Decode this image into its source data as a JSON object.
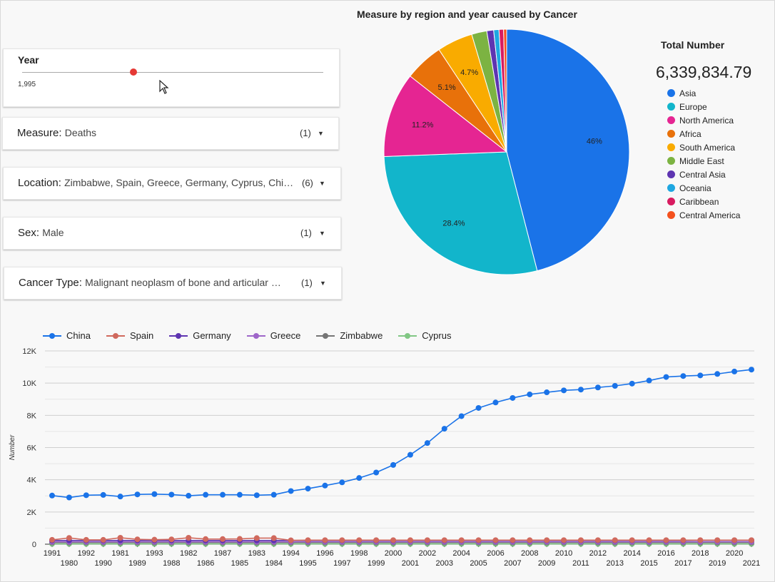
{
  "year_filter": {
    "title": "Year",
    "value": "1,995",
    "level": 0.37
  },
  "filters": [
    {
      "name": "Measure",
      "value": "Deaths",
      "count": "(1)"
    },
    {
      "name": "Location",
      "value": "Zimbabwe, Spain, Greece, Germany, Cyprus, Chi…",
      "count": "(6)"
    },
    {
      "name": "Sex",
      "value": "Male",
      "count": "(1)"
    },
    {
      "name": "Cancer Type",
      "value": "Malignant neoplasm of bone and articular …",
      "count": "(1)"
    }
  ],
  "pie": {
    "title": "Measure by region and year caused by Cancer",
    "total_title": "Total Number",
    "total_value": "6,339,834.79"
  },
  "line_legend": [
    "China",
    "Spain",
    "Germany",
    "Greece",
    "Zimbabwe",
    "Cyprus"
  ],
  "chart_data": [
    {
      "type": "pie",
      "title": "Measure by region and year caused by Cancer",
      "categories": [
        "Asia",
        "Europe",
        "North America",
        "Africa",
        "South America",
        "Middle East",
        "Central Asia",
        "Oceania",
        "Caribbean",
        "Central America"
      ],
      "values": [
        46,
        28.4,
        11.2,
        5.1,
        4.7,
        2.0,
        0.9,
        0.7,
        0.6,
        0.4
      ],
      "labels": [
        "46%",
        "28.4%",
        "11.2%",
        "5.1%",
        "4.7%",
        "",
        "",
        "",
        "",
        ""
      ],
      "colors": [
        "#1a73e8",
        "#12b5cb",
        "#e52592",
        "#e8710a",
        "#f9ab00",
        "#7cb342",
        "#5e35b1",
        "#1ea7e1",
        "#d81b60",
        "#f4511e"
      ],
      "legend_position": "right"
    },
    {
      "type": "line",
      "x": [
        "1991",
        "1980",
        "1992",
        "1990",
        "1981",
        "1989",
        "1993",
        "1988",
        "1982",
        "1986",
        "1987",
        "1985",
        "1983",
        "1984",
        "1994",
        "1995",
        "1996",
        "1997",
        "1998",
        "1999",
        "2000",
        "2001",
        "2002",
        "2003",
        "2004",
        "2005",
        "2006",
        "2007",
        "2008",
        "2009",
        "2010",
        "2011",
        "2012",
        "2013",
        "2014",
        "2015",
        "2016",
        "2017",
        "2018",
        "2019",
        "2020",
        "2021"
      ],
      "ylabel": "Number",
      "ylim": [
        0,
        12000
      ],
      "yticks": [
        "0",
        "2K",
        "4K",
        "6K",
        "8K",
        "10K",
        "12K"
      ],
      "grid": true,
      "legend_position": "top",
      "series": [
        {
          "name": "China",
          "color": "#1a73e8",
          "values": [
            3020,
            2900,
            3040,
            3060,
            2960,
            3090,
            3110,
            3080,
            3010,
            3070,
            3070,
            3070,
            3040,
            3070,
            3300,
            3450,
            3640,
            3840,
            4110,
            4450,
            4920,
            5550,
            6280,
            7170,
            7950,
            8460,
            8800,
            9080,
            9300,
            9430,
            9550,
            9600,
            9730,
            9830,
            9970,
            10160,
            10380,
            10440,
            10480,
            10570,
            10720,
            10840
          ]
        },
        {
          "name": "Spain",
          "color": "#d0695d",
          "values": [
            270,
            390,
            270,
            270,
            400,
            300,
            280,
            300,
            400,
            320,
            320,
            330,
            380,
            380,
            240,
            250,
            250,
            250,
            250,
            250,
            250,
            250,
            250,
            250,
            250,
            250,
            250,
            250,
            250,
            250,
            250,
            250,
            250,
            250,
            250,
            250,
            250,
            250,
            250,
            250,
            250,
            250
          ]
        },
        {
          "name": "Germany",
          "color": "#5e35b1",
          "values": [
            230,
            230,
            230,
            230,
            230,
            230,
            230,
            230,
            230,
            230,
            230,
            230,
            230,
            230,
            230,
            230,
            230,
            230,
            230,
            230,
            230,
            230,
            230,
            230,
            230,
            230,
            230,
            230,
            230,
            230,
            230,
            230,
            230,
            230,
            230,
            230,
            230,
            230,
            240,
            240,
            240,
            240
          ]
        },
        {
          "name": "Greece",
          "color": "#9e66c9",
          "values": [
            150,
            150,
            150,
            150,
            150,
            150,
            150,
            150,
            150,
            150,
            150,
            150,
            150,
            150,
            150,
            150,
            150,
            150,
            150,
            150,
            150,
            150,
            150,
            150,
            150,
            150,
            150,
            150,
            150,
            150,
            150,
            150,
            150,
            150,
            150,
            150,
            150,
            150,
            150,
            150,
            150,
            150
          ]
        },
        {
          "name": "Zimbabwe",
          "color": "#757575",
          "values": [
            100,
            100,
            100,
            100,
            100,
            100,
            100,
            100,
            100,
            100,
            100,
            100,
            100,
            100,
            100,
            100,
            100,
            100,
            100,
            100,
            100,
            100,
            100,
            100,
            100,
            100,
            100,
            100,
            100,
            100,
            100,
            100,
            100,
            100,
            100,
            100,
            100,
            100,
            100,
            100,
            100,
            100
          ]
        },
        {
          "name": "Cyprus",
          "color": "#81c784",
          "values": [
            20,
            20,
            20,
            20,
            20,
            20,
            20,
            20,
            20,
            20,
            20,
            20,
            20,
            20,
            20,
            20,
            20,
            20,
            20,
            20,
            20,
            20,
            20,
            20,
            20,
            20,
            20,
            20,
            20,
            20,
            20,
            20,
            20,
            20,
            20,
            20,
            20,
            20,
            20,
            20,
            20,
            20
          ]
        }
      ]
    }
  ]
}
